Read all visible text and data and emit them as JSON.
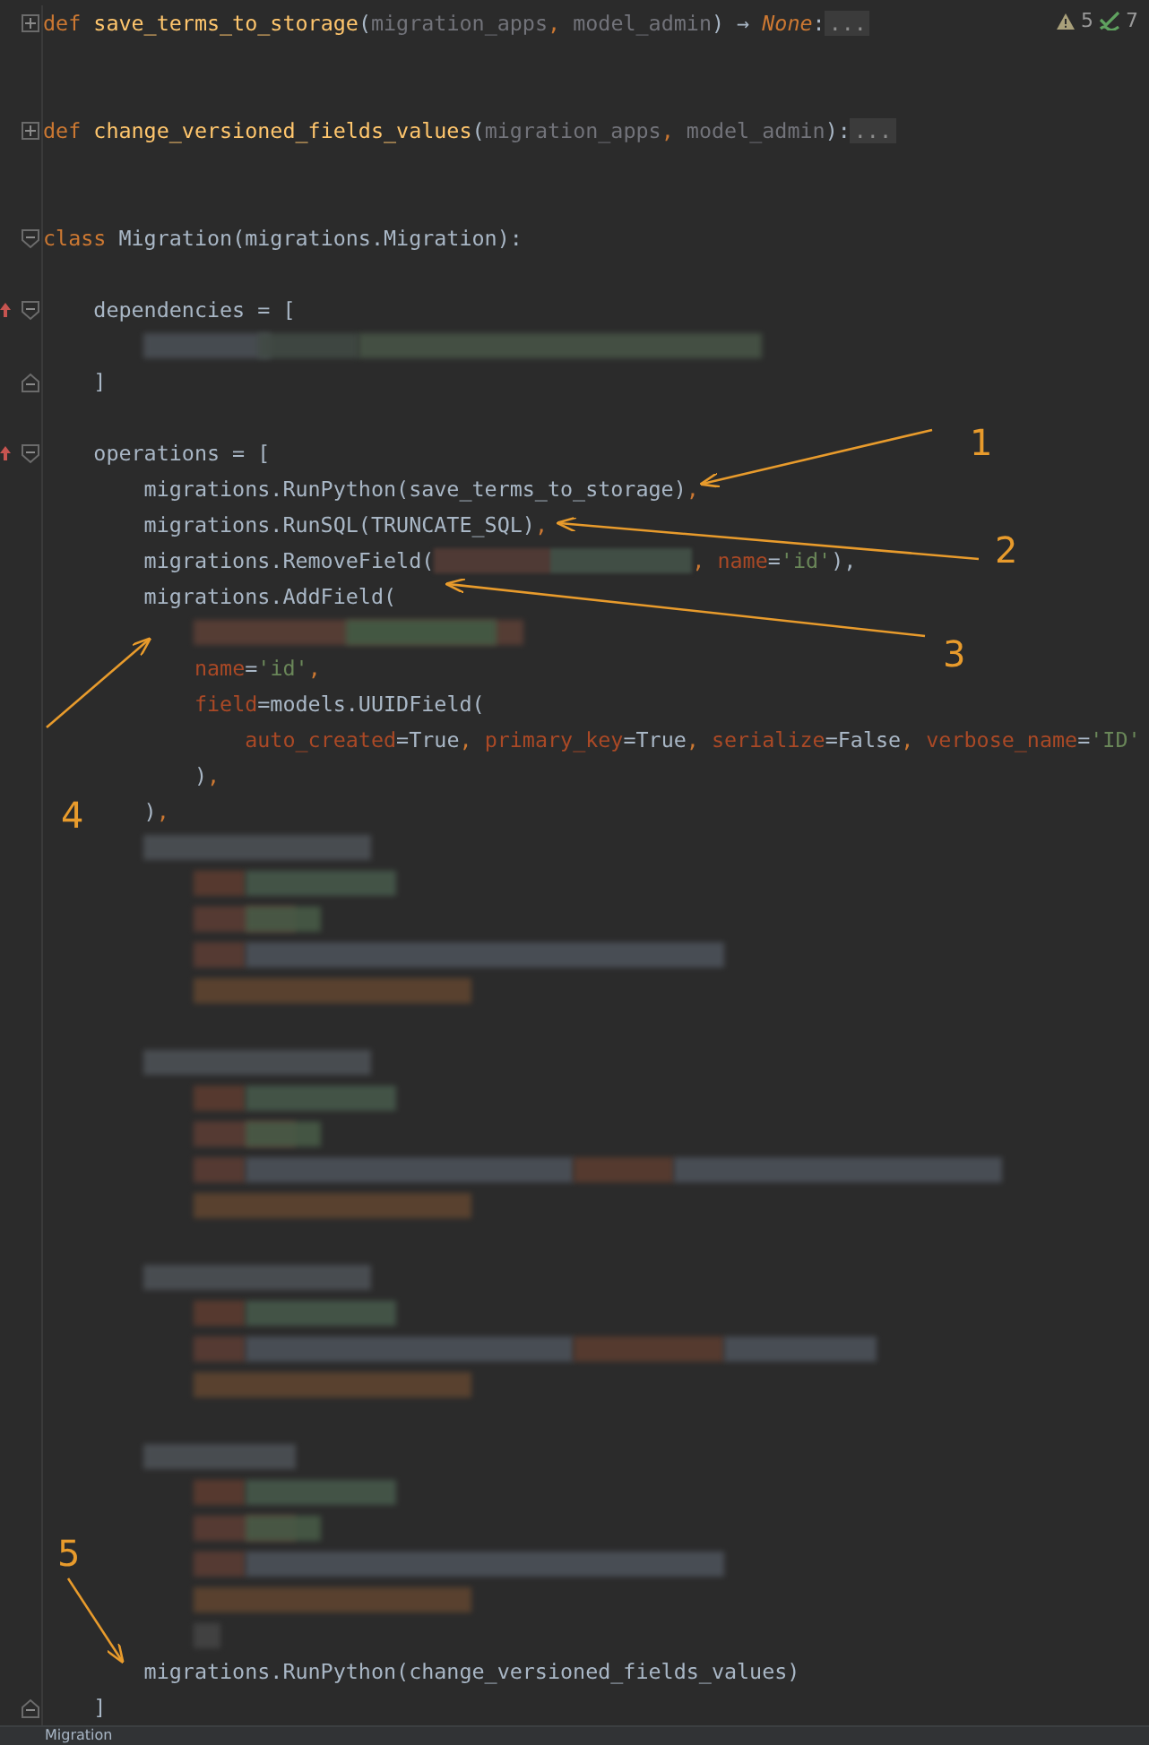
{
  "inspections": {
    "warnings": "5",
    "weak_warnings": "7"
  },
  "lines": [
    {
      "kind": "code",
      "fold": {
        "kind": "collapsed"
      },
      "tokens": [
        {
          "text": "def ",
          "kind": "keyword"
        },
        {
          "text": "save_terms_to_storage",
          "kind": "fn"
        },
        {
          "text": "(",
          "kind": "plain"
        },
        {
          "text": "migration_apps",
          "kind": "param"
        },
        {
          "text": ", ",
          "kind": "keyword"
        },
        {
          "text": "model_admin",
          "kind": "param"
        },
        {
          "text": ") → ",
          "kind": "plain"
        },
        {
          "text": "None",
          "kind": "italic"
        },
        {
          "text": ":",
          "kind": "plain"
        },
        {
          "text": "...",
          "kind": "placeholder"
        }
      ]
    },
    {
      "kind": "blank"
    },
    {
      "kind": "blank"
    },
    {
      "kind": "code",
      "fold": {
        "kind": "collapsed"
      },
      "tokens": [
        {
          "text": "def ",
          "kind": "keyword"
        },
        {
          "text": "change_versioned_fields_values",
          "kind": "fn"
        },
        {
          "text": "(",
          "kind": "plain"
        },
        {
          "text": "migration_apps",
          "kind": "param"
        },
        {
          "text": ", ",
          "kind": "keyword"
        },
        {
          "text": "model_admin",
          "kind": "param"
        },
        {
          "text": "):",
          "kind": "plain"
        },
        {
          "text": "...",
          "kind": "placeholder"
        }
      ]
    },
    {
      "kind": "blank"
    },
    {
      "kind": "blank"
    },
    {
      "kind": "code",
      "fold": {
        "kind": "open"
      },
      "tokens": [
        {
          "text": "class ",
          "kind": "keyword"
        },
        {
          "text": "Migration(migrations.Migration):",
          "kind": "plain"
        }
      ]
    },
    {
      "kind": "blank"
    },
    {
      "kind": "code",
      "fold": {
        "kind": "open"
      },
      "override": true,
      "tokens": [
        {
          "text": "    dependencies = [",
          "kind": "plain"
        }
      ]
    },
    {
      "kind": "redacted"
    },
    {
      "kind": "code",
      "fold": {
        "kind": "end"
      },
      "tokens": [
        {
          "text": "    ]",
          "kind": "plain"
        }
      ]
    },
    {
      "kind": "blank"
    },
    {
      "kind": "code",
      "fold": {
        "kind": "open"
      },
      "override": true,
      "tokens": [
        {
          "text": "    operations = [",
          "kind": "plain"
        }
      ]
    },
    {
      "kind": "code",
      "tokens": [
        {
          "text": "        migrations.RunPython(save_terms_to_storage)",
          "kind": "plain"
        },
        {
          "text": ",",
          "kind": "keyword"
        }
      ]
    },
    {
      "kind": "code",
      "tokens": [
        {
          "text": "        migrations.RunSQL(TRUNCATE_SQL)",
          "kind": "plain"
        },
        {
          "text": ",",
          "kind": "keyword"
        }
      ]
    },
    {
      "kind": "code",
      "redacted_inline": true,
      "tokens": [
        {
          "text": "        migrations.RemoveField(",
          "kind": "plain"
        },
        {
          "text": ", ",
          "kind": "keyword"
        },
        {
          "text": "name",
          "kind": "kwarg"
        },
        {
          "text": "=",
          "kind": "plain"
        },
        {
          "text": "'id'",
          "kind": "string"
        },
        {
          "text": "),",
          "kind": "plain"
        }
      ]
    },
    {
      "kind": "code",
      "tokens": [
        {
          "text": "        migrations.AddField(",
          "kind": "plain"
        }
      ]
    },
    {
      "kind": "redacted"
    },
    {
      "kind": "code",
      "tokens": [
        {
          "text": "            name",
          "kind": "kwarg"
        },
        {
          "text": "=",
          "kind": "plain"
        },
        {
          "text": "'id'",
          "kind": "string"
        },
        {
          "text": ",",
          "kind": "keyword"
        }
      ]
    },
    {
      "kind": "code",
      "tokens": [
        {
          "text": "            field",
          "kind": "kwarg"
        },
        {
          "text": "=models.UUIDField(",
          "kind": "plain"
        }
      ]
    },
    {
      "kind": "code",
      "tokens": [
        {
          "text": "                auto_created",
          "kind": "kwarg"
        },
        {
          "text": "=True",
          "kind": "plain"
        },
        {
          "text": ", ",
          "kind": "keyword"
        },
        {
          "text": "primary_key",
          "kind": "kwarg"
        },
        {
          "text": "=True",
          "kind": "plain"
        },
        {
          "text": ", ",
          "kind": "keyword"
        },
        {
          "text": "serialize",
          "kind": "kwarg"
        },
        {
          "text": "=False",
          "kind": "plain"
        },
        {
          "text": ", ",
          "kind": "keyword"
        },
        {
          "text": "verbose_name",
          "kind": "kwarg"
        },
        {
          "text": "=",
          "kind": "plain"
        },
        {
          "text": "'ID'",
          "kind": "string"
        }
      ]
    },
    {
      "kind": "code",
      "tokens": [
        {
          "text": "            )",
          "kind": "plain"
        },
        {
          "text": ",",
          "kind": "keyword"
        }
      ]
    },
    {
      "kind": "code",
      "tokens": [
        {
          "text": "        )",
          "kind": "plain"
        },
        {
          "text": ",",
          "kind": "keyword"
        }
      ]
    },
    {
      "kind": "redacted"
    },
    {
      "kind": "redacted"
    },
    {
      "kind": "redacted"
    },
    {
      "kind": "redacted"
    },
    {
      "kind": "redacted"
    },
    {
      "kind": "blank"
    },
    {
      "kind": "redacted"
    },
    {
      "kind": "redacted"
    },
    {
      "kind": "redacted"
    },
    {
      "kind": "redacted"
    },
    {
      "kind": "redacted"
    },
    {
      "kind": "blank"
    },
    {
      "kind": "redacted"
    },
    {
      "kind": "redacted"
    },
    {
      "kind": "redacted"
    },
    {
      "kind": "redacted"
    },
    {
      "kind": "blank"
    },
    {
      "kind": "redacted"
    },
    {
      "kind": "redacted"
    },
    {
      "kind": "redacted"
    },
    {
      "kind": "redacted"
    },
    {
      "kind": "redacted"
    },
    {
      "kind": "redacted"
    },
    {
      "kind": "code",
      "tokens": [
        {
          "text": "        migrations.RunPython(change_versioned_fields_values)",
          "kind": "plain"
        }
      ]
    },
    {
      "kind": "code",
      "fold": {
        "kind": "end"
      },
      "tokens": [
        {
          "text": "    ]",
          "kind": "plain"
        }
      ]
    }
  ],
  "breadcrumb": "Migration",
  "annotations": [
    {
      "label": "1"
    },
    {
      "label": "2"
    },
    {
      "label": "3"
    },
    {
      "label": "4"
    },
    {
      "label": "5"
    }
  ]
}
